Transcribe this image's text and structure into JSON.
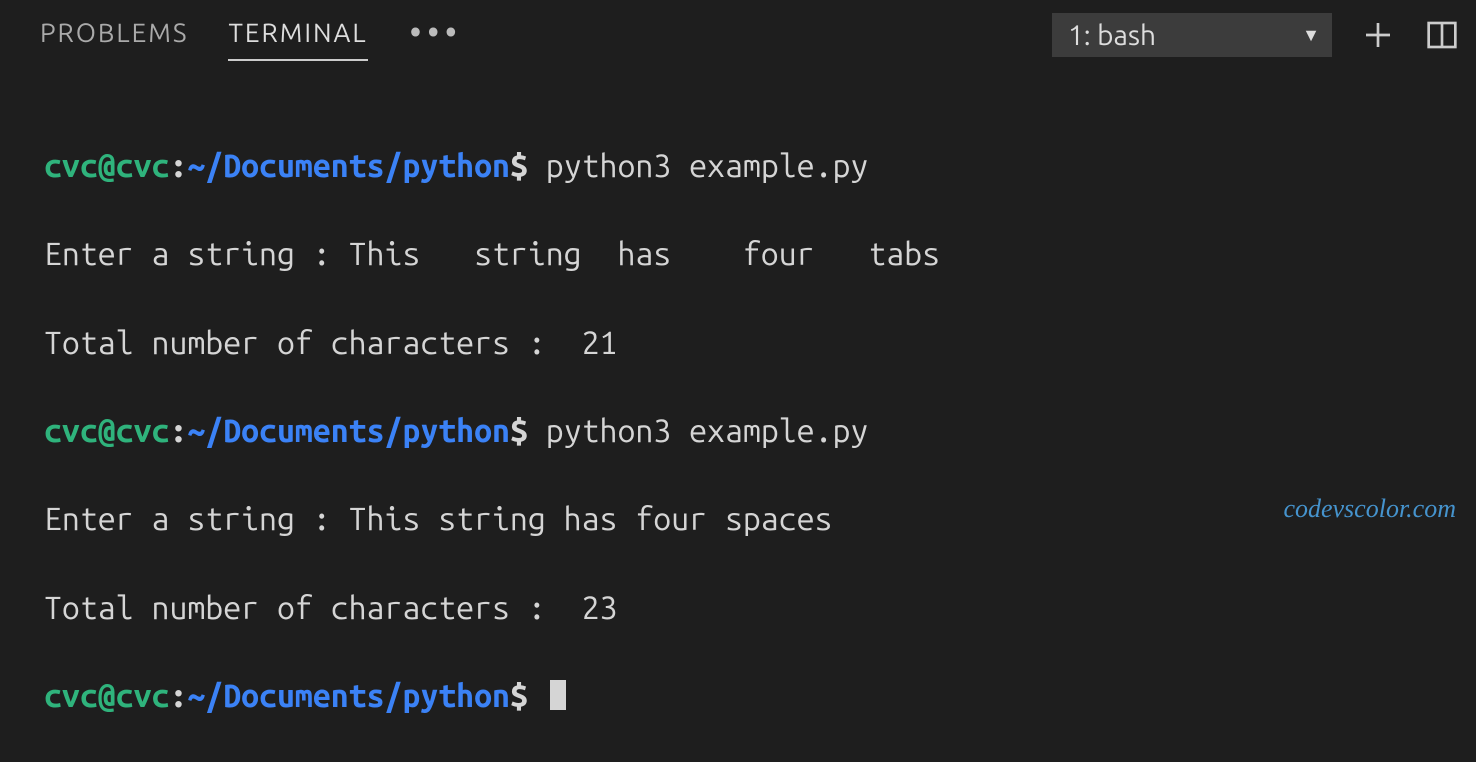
{
  "tabs": {
    "problems": "PROBLEMS",
    "terminal": "TERMINAL"
  },
  "shell": {
    "selected": "1: bash"
  },
  "prompt": {
    "user": "cvc@cvc",
    "sep1": ":",
    "path": "~/Documents/python",
    "sep2": "$"
  },
  "lines": {
    "cmd1": " python3 example.py",
    "out1a": "Enter a string : This   string  has    four   tabs",
    "out1b": "Total number of characters :  21",
    "cmd2": " python3 example.py",
    "out2a": "Enter a string : This string has four spaces",
    "out2b": "Total number of characters :  23"
  },
  "watermark": "codevscolor.com"
}
